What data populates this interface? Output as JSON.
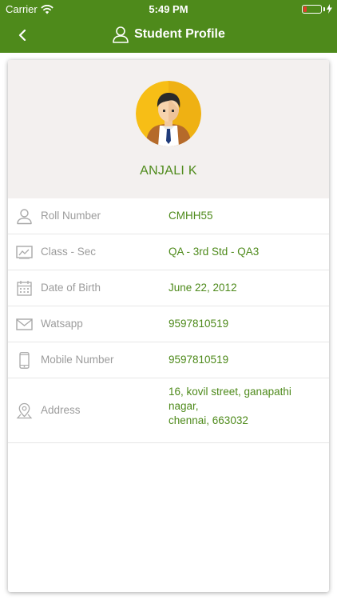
{
  "status_bar": {
    "carrier": "Carrier",
    "time": "5:49 PM"
  },
  "header": {
    "title": "Student Profile",
    "back_icon": "chevron-left-icon",
    "title_icon": "person-outline-icon"
  },
  "profile": {
    "name": "ANJALI K",
    "avatar": "student-avatar-illustration"
  },
  "details": [
    {
      "label": "Roll Number",
      "value": "CMHH55",
      "icon": "person-icon"
    },
    {
      "label": "Class - Sec",
      "value": "QA - 3rd Std -  QA3",
      "icon": "chart-icon"
    },
    {
      "label": "Date of Birth",
      "value": "June 22, 2012",
      "icon": "calendar-icon"
    },
    {
      "label": "Watsapp",
      "value": "9597810519",
      "icon": "mail-icon"
    },
    {
      "label": "Mobile Number",
      "value": "9597810519",
      "icon": "phone-icon"
    },
    {
      "label": "Address",
      "value_lines": [
        "16, kovil street, ganapathi",
        "nagar,",
        "chennai, 663032"
      ],
      "icon": "location-pin-icon"
    }
  ],
  "colors": {
    "primary": "#4e8a1b",
    "hero_bg": "#f3f0ef",
    "label": "#9c9c9c"
  }
}
